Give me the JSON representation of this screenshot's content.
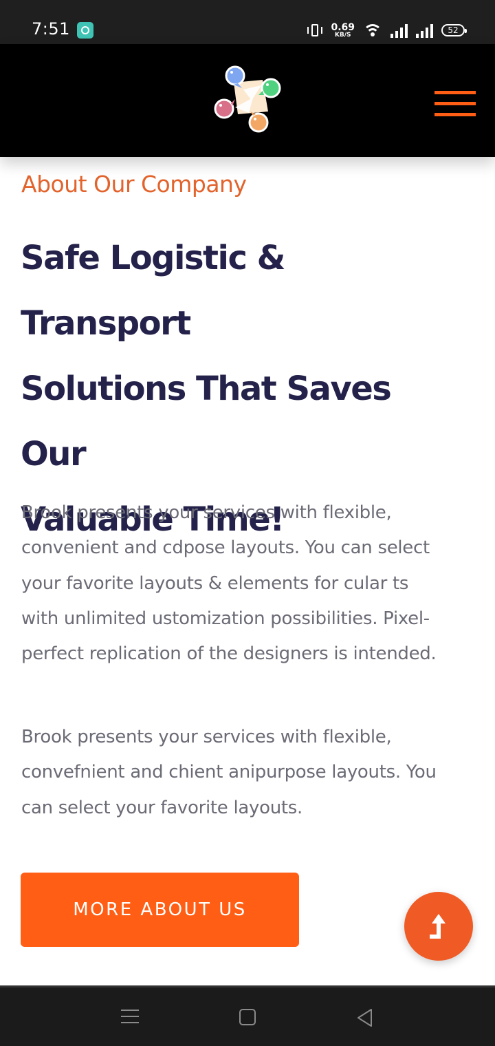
{
  "status_bar": {
    "time": "7:51",
    "net_speed_value": "0.69",
    "net_speed_unit": "KB/S",
    "battery": "52",
    "icons": [
      "app-notification-icon",
      "vibrate-icon",
      "wifi-icon",
      "signal-icon",
      "signal-icon",
      "battery-icon"
    ]
  },
  "header": {
    "logo": "logo-icon",
    "menu_icon": "hamburger-menu-icon"
  },
  "content": {
    "section_label": "About Our Company",
    "heading_lines": [
      "Safe Logistic & Transport",
      "Solutions That Saves Our",
      "Valuable Time!"
    ],
    "paragraph_1_lines": [
      "Brook presents your services with flexible,",
      "convenient and cdpose layouts. You can select",
      "your favorite layouts & elements for cular ts",
      "with unlimited ustomization possibilities. Pixel-",
      "perfect replication of the designers is intended."
    ],
    "paragraph_2_lines": [
      "Brook presents your services with flexible,",
      "convefnient and chient anipurpose layouts. You",
      "can select your favorite layouts."
    ],
    "cta_label": "MORE ABOUT US",
    "scroll_top_icon": "arrow-up-icon"
  },
  "nav_bar": {
    "icons": [
      "recents-icon",
      "home-icon",
      "back-icon"
    ]
  },
  "colors": {
    "accent": "#ff5e14",
    "label": "#e2632b",
    "heading": "#24224a",
    "body_text": "#6b6b76",
    "header_bg": "#000000"
  }
}
